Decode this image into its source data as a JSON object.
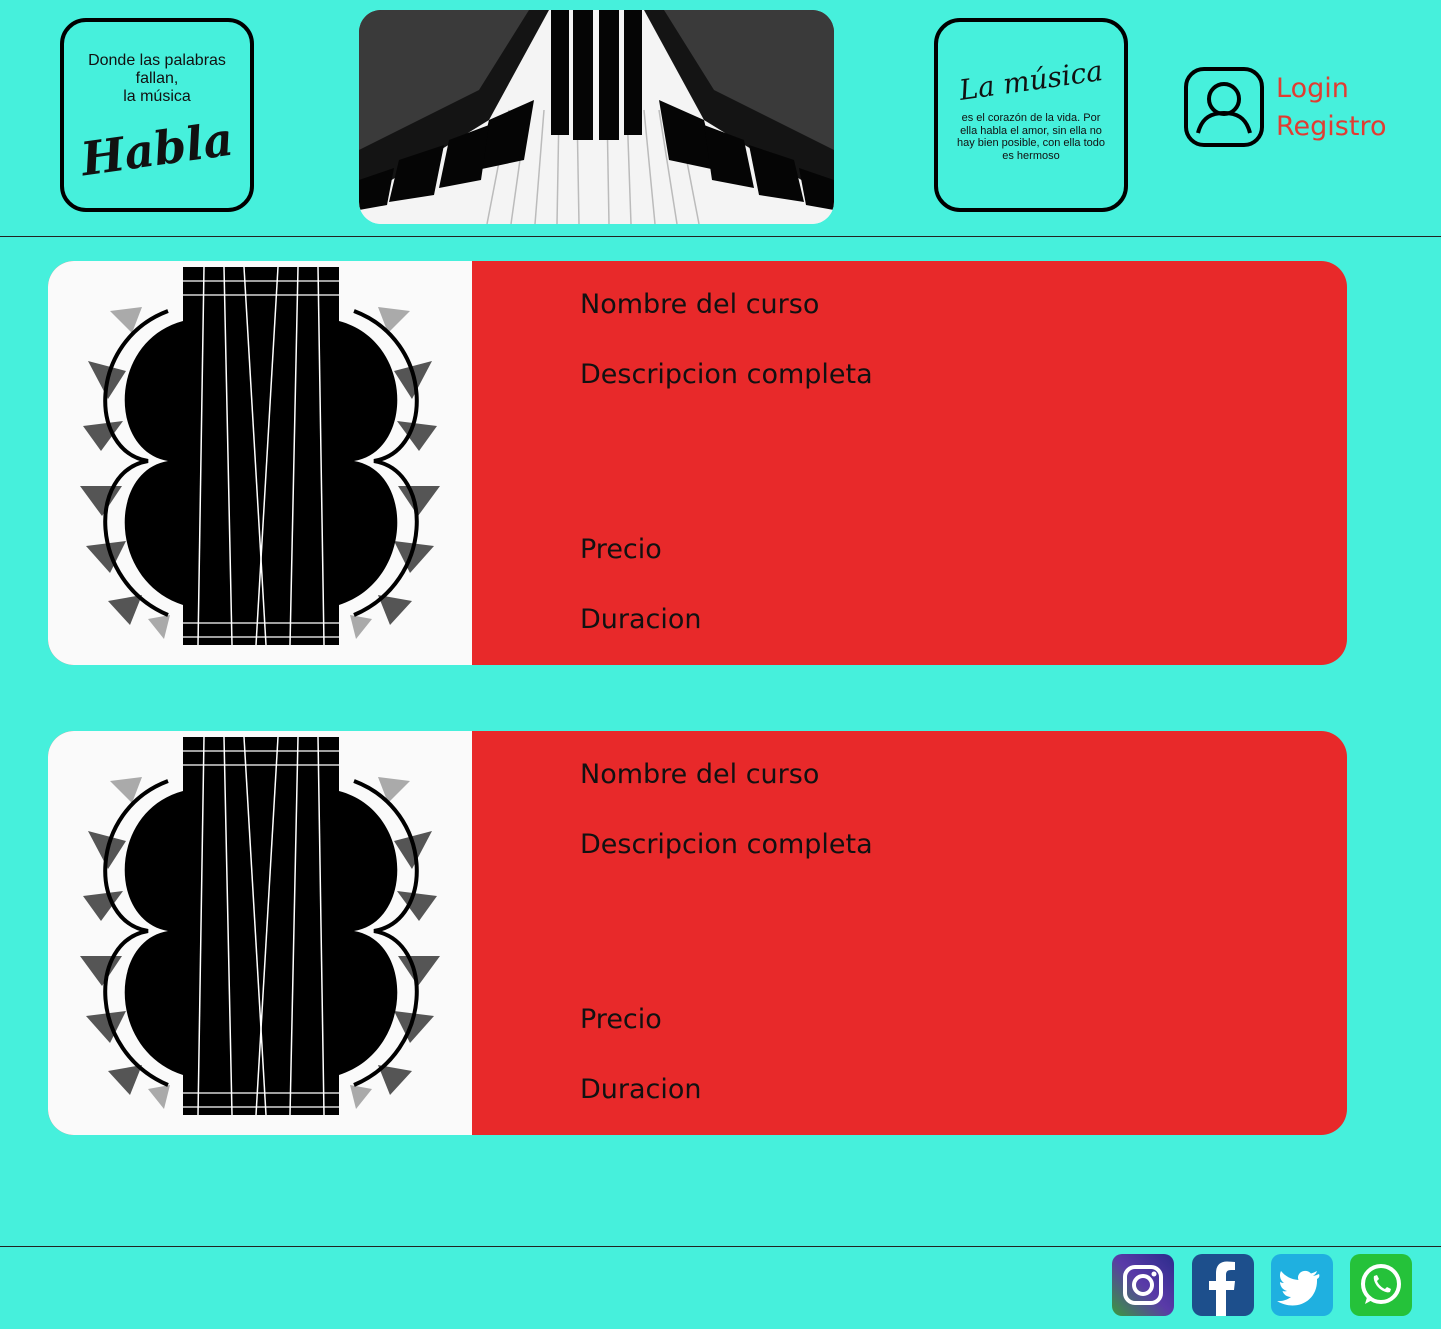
{
  "header": {
    "left_quote": {
      "line1": "Donde las palabras",
      "line2": "fallan,",
      "line3": "la música",
      "script": "Habla"
    },
    "right_quote": {
      "script": "La música",
      "body": "es el corazón de la vida. Por ella habla el amor, sin ella no hay bien posible, con ella todo es hermoso"
    },
    "auth": {
      "login": "Login",
      "register": "Registro"
    }
  },
  "courses": [
    {
      "name": "Nombre del curso",
      "description": "Descripcion completa",
      "price": "Precio",
      "duration": "Duracion"
    },
    {
      "name": "Nombre del curso",
      "description": "Descripcion completa",
      "price": "Precio",
      "duration": "Duracion"
    }
  ],
  "colors": {
    "background": "#46f0dc",
    "card": "#e8292a",
    "link": "#e13c32"
  },
  "footer": {
    "social": [
      "instagram-icon",
      "facebook-icon",
      "twitter-icon",
      "whatsapp-icon"
    ]
  }
}
